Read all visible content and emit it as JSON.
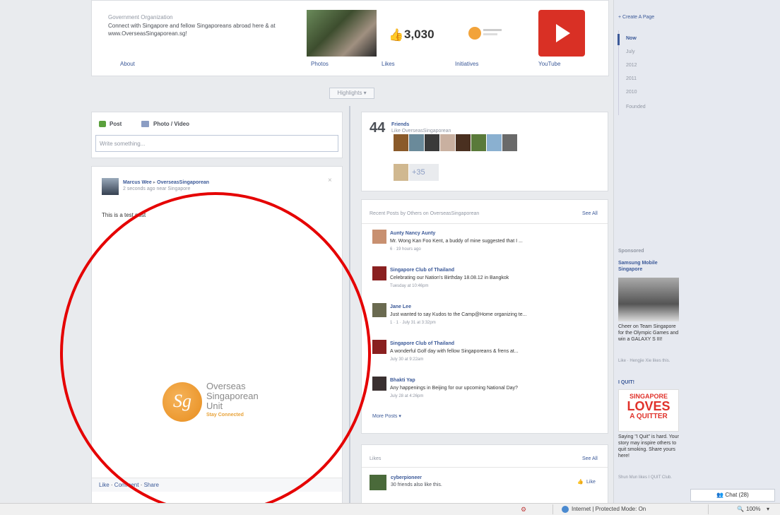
{
  "page": {
    "org_type": "Government Organization",
    "description": "Connect with Singapore and fellow Singaporeans abroad here & at www.OverseasSingaporean.sg!"
  },
  "header": {
    "likes_count": "3,030",
    "tabs": [
      "About",
      "Photos",
      "Likes",
      "Initiatives",
      "YouTube"
    ]
  },
  "highlights_label": "Highlights ▾",
  "composer": {
    "post_label": "Post",
    "photo_label": "Photo / Video",
    "placeholder": "Write something..."
  },
  "post": {
    "author": "Marcus Wee",
    "arrow": "▸",
    "target": "OverseasSingaporean",
    "meta": "2 seconds ago near Singapore",
    "body": "This is a test post",
    "logo_line1": "Overseas",
    "logo_line2": "Singaporean",
    "logo_line3": "Unit",
    "logo_tagline": "Stay Connected",
    "actions": [
      "Like",
      "Comment",
      "Share"
    ]
  },
  "friends": {
    "count": "44",
    "label": "Friends",
    "sub": "Like OverseasSingaporean",
    "more": "+35"
  },
  "recent": {
    "title": "Recent Posts by Others on OverseasSingaporean",
    "see_all": "See All",
    "more": "More Posts ▾",
    "items": [
      {
        "name": "Aunty Nancy Aunty",
        "text": "Mr. Wong Kan Foo Kent, a buddy of mine suggested that I ...",
        "meta": "6 · 19 hours ago"
      },
      {
        "name": "Singapore Club of Thailand",
        "text": "Celebrating our Nation's Birthday 18.08.12 in Bangkok",
        "meta": "Tuesday at 10:46pm"
      },
      {
        "name": "Jane Lee",
        "text": "Just wanted to say Kudos to the Camp@Home organizing te...",
        "meta": "1 · 1 · July 31 at 3:32pm"
      },
      {
        "name": "Singapore Club of Thailand",
        "text": "A wonderful Golf day with fellow Singaporeans & frens at...",
        "meta": "July 30 at 9:22am"
      },
      {
        "name": "Bhakti Yap",
        "text": "Any happenings in Beijing for our upcoming National Day?",
        "meta": "July 28 at 4:26pm"
      }
    ]
  },
  "likes": {
    "title": "Likes",
    "see_all": "See All",
    "name": "cyberpioneer",
    "sub": "30 friends also like this.",
    "like_btn": "Like"
  },
  "rail": {
    "create_page": "+ Create A Page",
    "years": [
      "Now",
      "July",
      "2012",
      "2011",
      "2010",
      "Founded"
    ],
    "sponsored": "Sponsored",
    "ad1_title": "Samsung Mobile Singapore",
    "ad1_text": "Cheer on Team Singapore for the Olympic Games and win a GALAXY S III!",
    "ad1_like": "Like · Hengjie Xie likes this.",
    "ad2_title": "I QUIT!",
    "ad2_img1": "SINGAPORE",
    "ad2_img2": "LOVES",
    "ad2_img3": "A QUITTER",
    "ad2_text": "Saying \"I Quit\" is hard. Your story may inspire others to quit smoking. Share yours here!",
    "ad2_like": "Shun Mun likes I QUIT Club.",
    "chat": "Chat (28)"
  },
  "statusbar": {
    "zone": "Internet | Protected Mode: On",
    "zoom": "100%"
  }
}
